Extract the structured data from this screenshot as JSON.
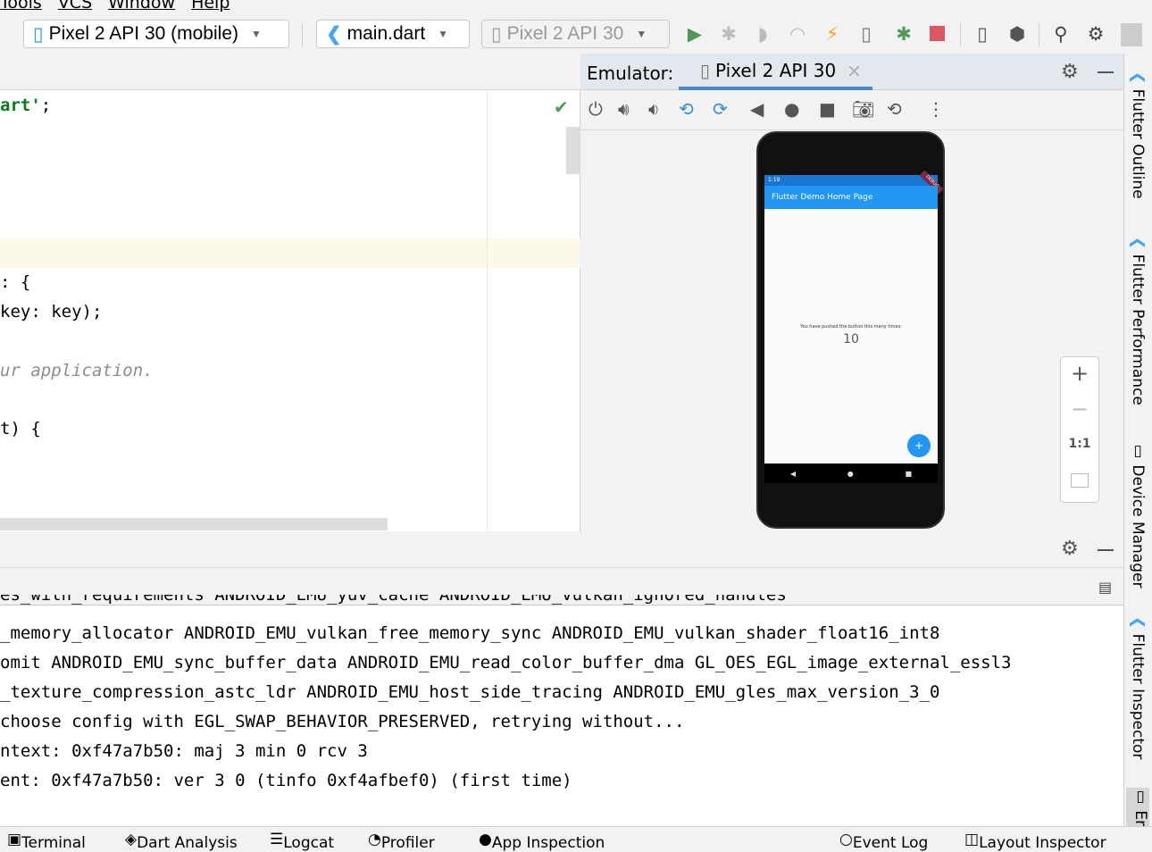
{
  "menu": [
    "Tools",
    "VCS",
    "Window",
    "Help"
  ],
  "toolbar": {
    "device": "Pixel 2 API 30 (mobile)",
    "config": "main.dart",
    "target": "Pixel 2 API 30",
    "icons": [
      "run-icon",
      "debug-icon",
      "coverage-icon",
      "profile-icon",
      "hot-reload-icon",
      "hot-restart-icon",
      "attach-debugger-icon",
      "stop-icon",
      "device-manager-icon",
      "sdk-manager-icon",
      "search-icon",
      "settings-icon",
      "avatar-icon"
    ]
  },
  "editor": {
    "lines": [
      {
        "text": "art'",
        "tail": ";",
        "kind": "string"
      },
      {
        "text": ": {",
        "kind": "code"
      },
      {
        "text": "key: key);",
        "kind": "code"
      },
      {
        "text": "ur application.",
        "kind": "comment"
      },
      {
        "text": "t) {",
        "kind": "code"
      }
    ]
  },
  "emulator": {
    "label": "Emulator:",
    "tab": "Pixel 2 API 30",
    "app_title": "Flutter Demo Home Page",
    "status_time": "1:19",
    "debug_banner": "DEBUG",
    "message": "You have pushed the button this many times:",
    "counter": "10",
    "fab": "+",
    "zoom": {
      "in": "+",
      "out": "−",
      "actual": "1:1"
    }
  },
  "sidebar": [
    "Flutter Outline",
    "Flutter Performance",
    "Device Manager",
    "Flutter Inspector",
    "Em"
  ],
  "log": [
    "es_with_requirements ANDROID_EMU_yuv_cache ANDROID_EMU_vulkan_ignored_handles",
    "_memory_allocator ANDROID_EMU_vulkan_free_memory_sync ANDROID_EMU_vulkan_shader_float16_int8",
    "omit ANDROID_EMU_sync_buffer_data ANDROID_EMU_read_color_buffer_dma GL_OES_EGL_image_external_essl3",
    "_texture_compression_astc_ldr ANDROID_EMU_host_side_tracing ANDROID_EMU_gles_max_version_3_0",
    "choose config with EGL_SWAP_BEHAVIOR_PRESERVED, retrying without...",
    "ntext: 0xf47a7b50: maj 3 min 0 rcv 3",
    "ent: 0xf47a7b50: ver 3 0 (tinfo 0xf4afbef0) (first time)"
  ],
  "status": {
    "terminal": "Terminal",
    "dart": "Dart Analysis",
    "logcat": "Logcat",
    "profiler": "Profiler",
    "inspection": "App Inspection",
    "eventlog": "Event Log",
    "layout": "Layout Inspector"
  },
  "colors": {
    "accent": "#4a86c8",
    "appbar": "#2196f3",
    "run": "#4e9a56",
    "stop": "#db5860",
    "string": "#067d17",
    "comment": "#8c8c8c"
  }
}
